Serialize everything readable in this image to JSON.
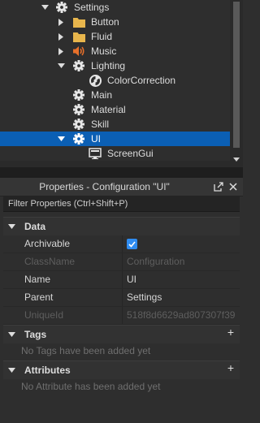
{
  "explorer": {
    "items": [
      {
        "label": "Settings",
        "icon": "gear-icon"
      },
      {
        "label": "Button",
        "icon": "folder-icon"
      },
      {
        "label": "Fluid",
        "icon": "folder-icon"
      },
      {
        "label": "Music",
        "icon": "sound-icon"
      },
      {
        "label": "Lighting",
        "icon": "gear-icon"
      },
      {
        "label": "ColorCorrection",
        "icon": "color-correction-icon"
      },
      {
        "label": "Main",
        "icon": "gear-icon"
      },
      {
        "label": "Material",
        "icon": "gear-icon"
      },
      {
        "label": "Skill",
        "icon": "gear-icon"
      },
      {
        "label": "UI",
        "icon": "gear-icon"
      },
      {
        "label": "ScreenGui",
        "icon": "screengui-icon"
      }
    ],
    "selected": "UI"
  },
  "properties": {
    "title": "Properties - Configuration \"UI\"",
    "filter_placeholder": "Filter Properties (Ctrl+Shift+P)",
    "sections": {
      "data": "Data",
      "tags": "Tags",
      "attributes": "Attributes"
    },
    "rows": [
      {
        "name": "Archivable",
        "value": "",
        "checked": true
      },
      {
        "name": "ClassName",
        "value": "Configuration"
      },
      {
        "name": "Name",
        "value": "UI"
      },
      {
        "name": "Parent",
        "value": "Settings"
      },
      {
        "name": "UniqueId",
        "value": "518f8d6629ad807307f39"
      }
    ],
    "tags_empty": "No Tags have been added yet",
    "attributes_empty": "No Attribute has been added yet"
  },
  "colors": {
    "background": "#2e2e2e",
    "selection": "#0b5fb4",
    "checkbox": "#2f8cf0",
    "folder": "#e8b64c",
    "sound": "#e8702a"
  }
}
